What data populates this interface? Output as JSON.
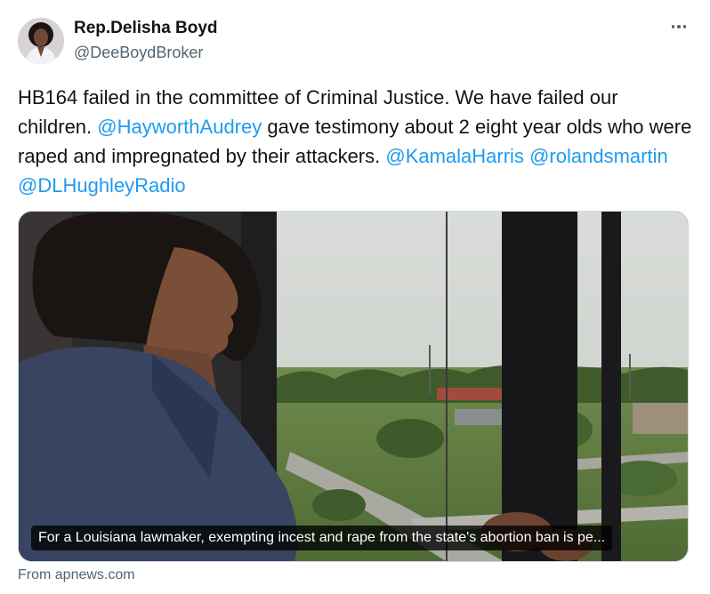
{
  "tweet": {
    "author_name": "Rep.Delisha Boyd",
    "author_handle": "@DeeBoydBroker",
    "text_parts": [
      "HB164 failed in the committee of Criminal Justice. We have failed our children. ",
      "@HayworthAudrey",
      " gave testimony about 2 eight year olds who were raped and impregnated by their attackers. ",
      "@KamalaHarris",
      " ",
      "@rolandsmartin",
      " ",
      "@DLHughleyRadio"
    ],
    "more_icon": "ellipsis-icon"
  },
  "card": {
    "caption": "For a Louisiana lawmaker, exempting incest and rape from the state's abortion ban is pe...",
    "source": "From apnews.com"
  },
  "colors": {
    "link": "#1d9bf0",
    "secondary_text": "#536471",
    "border": "#cfd9de"
  }
}
